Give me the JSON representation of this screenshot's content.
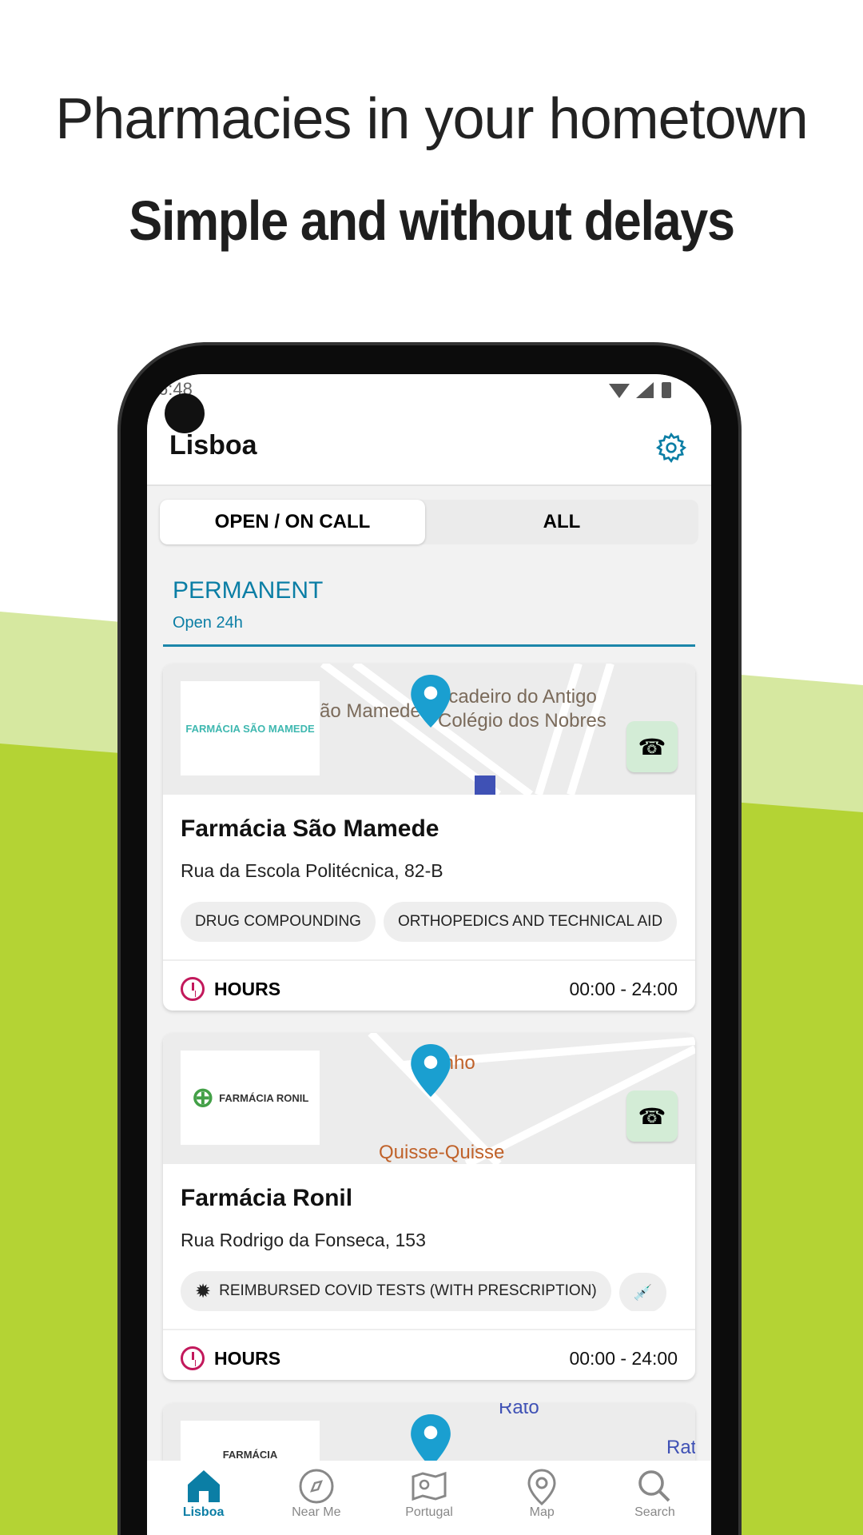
{
  "headline": "Pharmacies in your hometown",
  "subheadline": "Simple and without delays",
  "colors": {
    "accent": "#0b7ea5",
    "green_light": "#d6e8a0",
    "green": "#b4d334",
    "clock": "#c2185b"
  },
  "status": {
    "time": "6:48"
  },
  "app": {
    "title": "Lisboa",
    "settings_icon": "gear-icon"
  },
  "tabs": [
    {
      "label": "OPEN / ON CALL",
      "active": true
    },
    {
      "label": "ALL",
      "active": false
    }
  ],
  "section": {
    "title": "PERMANENT",
    "subtitle": "Open 24h"
  },
  "pharmacies": [
    {
      "name": "Farmácia São Mamede",
      "logo": "FARMÁCIA SÃO MAMEDE",
      "address": "Rua da Escola Politécnica, 82-B",
      "map_labels": [
        "ão Mamede",
        "icadeiro do Antigo",
        "Colégio dos Nobres"
      ],
      "services": [
        "DRUG COMPOUNDING",
        "ORTHOPEDICS AND TECHNICAL AID"
      ],
      "hours_label": "HOURS",
      "hours": "00:00 - 24:00"
    },
    {
      "name": "Farmácia Ronil",
      "logo": "FARMÁCIA RONIL",
      "address": "Rua Rodrigo da Fonseca, 153",
      "map_labels": [
        "Cinho",
        "Quisse-Quisse"
      ],
      "services": [
        "REIMBURSED COVID TESTS (WITH PRESCRIPTION)",
        ""
      ],
      "hours_label": "HOURS",
      "hours": "00:00 - 24:00"
    },
    {
      "logo": "FARMÁCIA",
      "map_labels": [
        "Rato",
        "Rat"
      ]
    }
  ],
  "nav": [
    {
      "label": "Lisboa",
      "icon": "home-icon"
    },
    {
      "label": "Near Me",
      "icon": "compass-icon"
    },
    {
      "label": "Portugal",
      "icon": "map-fold-icon"
    },
    {
      "label": "Map",
      "icon": "location-pin-icon"
    },
    {
      "label": "Search",
      "icon": "search-icon"
    }
  ]
}
